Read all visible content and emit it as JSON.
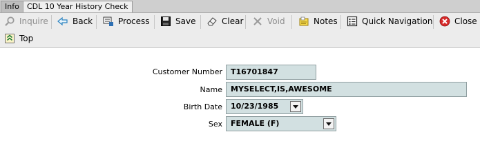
{
  "tabs": [
    {
      "label": "Info"
    },
    {
      "label": "CDL 10 Year History Check"
    }
  ],
  "toolbar": {
    "inquire": "Inquire",
    "back": "Back",
    "process": "Process",
    "save": "Save",
    "clear": "Clear",
    "void": "Void",
    "notes": "Notes",
    "quick_navigation": "Quick Navigation",
    "close": "Close",
    "top": "Top"
  },
  "form": {
    "customer_number": {
      "label": "Customer Number",
      "value": "T16701847"
    },
    "name": {
      "label": "Name",
      "value": "MYSELECT,IS,AWESOME"
    },
    "birth_date": {
      "label": "Birth Date",
      "value": "10/23/1985"
    },
    "sex": {
      "label": "Sex",
      "value": "FEMALE (F)"
    }
  },
  "colors": {
    "field_background": "#d2e0e1",
    "toolbar_background": "#ececec",
    "close_icon": "#d72a2a"
  },
  "icons": {
    "inquire": "magnifier-icon",
    "back": "back-arrow-icon",
    "process": "process-icon",
    "save": "floppy-disk-icon",
    "clear": "eraser-icon",
    "void": "x-icon",
    "notes": "notes-icon",
    "quick_navigation": "quick-navigation-icon",
    "close": "close-icon",
    "top": "top-icon"
  }
}
